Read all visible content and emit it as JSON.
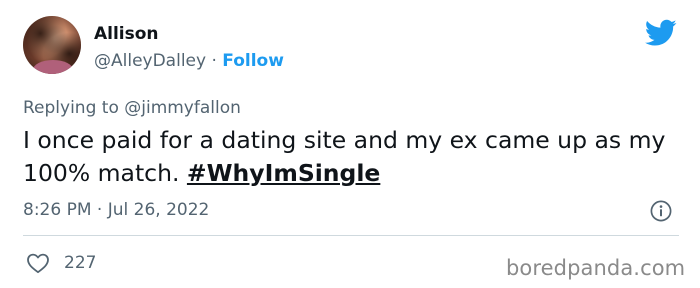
{
  "user": {
    "name": "Allison",
    "handle": "@AlleyDalley",
    "separator": "·",
    "follow_label": "Follow"
  },
  "reply": {
    "text": "Replying to @jimmyfallon"
  },
  "tweet": {
    "text": "I once paid for a dating site and my ex came up as my 100% match. ",
    "hashtag": "#WhyImSingle",
    "timestamp": "8:26 PM · Jul 26, 2022"
  },
  "actions": {
    "likes": "227"
  },
  "watermark": "boredpanda.com",
  "icons": {
    "brand": "twitter-bird-icon",
    "info": "info-icon",
    "like": "heart-icon"
  },
  "colors": {
    "accent": "#1d9bf0",
    "text": "#0f1419",
    "secondary": "#536471",
    "divider": "#cfd9de"
  }
}
